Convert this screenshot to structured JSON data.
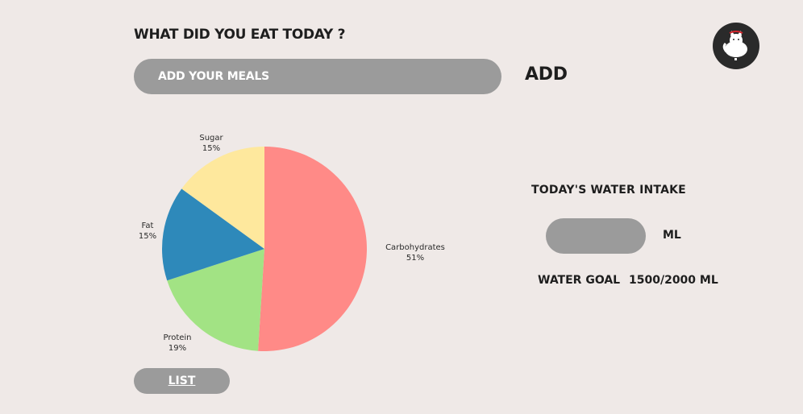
{
  "header": {
    "title": "WHAT DID YOU EAT TODAY ?",
    "meal_input_placeholder": "ADD YOUR MEALS",
    "add_label": "ADD"
  },
  "avatar": {
    "icon": "cat-icon"
  },
  "chart_data": {
    "type": "pie",
    "slices": [
      {
        "label": "Carbohydrates",
        "value": 51,
        "percent_label": "51%",
        "color": "#ff8a87"
      },
      {
        "label": "Protein",
        "value": 19,
        "percent_label": "19%",
        "color": "#a2e384"
      },
      {
        "label": "Fat",
        "value": 15,
        "percent_label": "15%",
        "color": "#2e89ba"
      },
      {
        "label": "Sugar",
        "value": 15,
        "percent_label": "15%",
        "color": "#fee89d"
      }
    ]
  },
  "list_button": {
    "label": "LIST"
  },
  "water": {
    "title": "TODAY'S WATER INTAKE",
    "unit_label": "ML",
    "goal_label": "WATER GOAL",
    "goal_value": "1500/2000 ML"
  }
}
